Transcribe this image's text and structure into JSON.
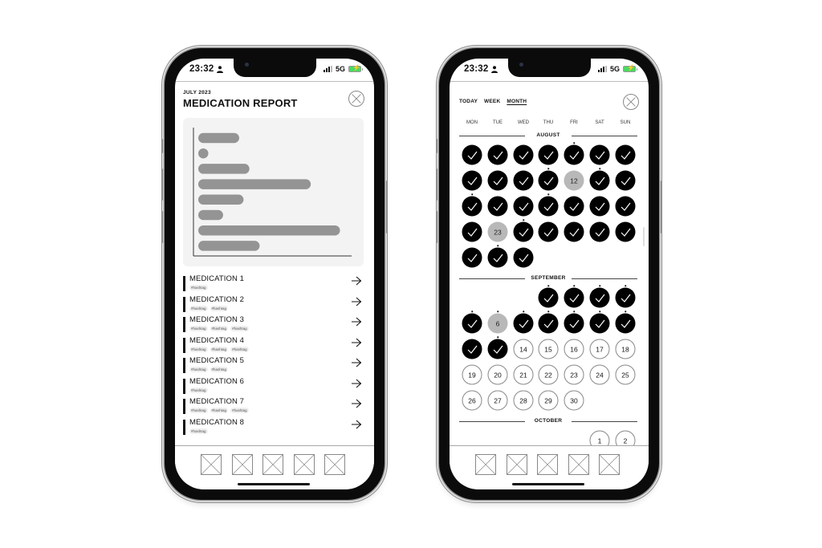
{
  "status_bar": {
    "time": "23:32",
    "network": "5G",
    "person_icon": "person-icon",
    "signal_icon": "signal-bars-icon",
    "battery_icon": "battery-charging-icon"
  },
  "report_screen": {
    "month_label": "JULY 2023",
    "title": "MEDICATION REPORT",
    "close_icon": "close-circle-icon",
    "chart_data": {
      "type": "bar",
      "orientation": "horizontal",
      "title": "",
      "xlabel": "",
      "ylabel": "",
      "categories": [
        "MEDICATION 1",
        "MEDICATION 2",
        "MEDICATION 3",
        "MEDICATION 4",
        "MEDICATION 5",
        "MEDICATION 6",
        "MEDICATION 7",
        "MEDICATION 8"
      ],
      "values": [
        28,
        4,
        35,
        77,
        31,
        17,
        97,
        42
      ],
      "xlim": [
        0,
        100
      ],
      "grid": false,
      "tick_labels_shown": false,
      "bar_color": "#949494"
    },
    "medications": [
      {
        "name": "MEDICATION 1",
        "tags": [
          "#hashtag"
        ]
      },
      {
        "name": "MEDICATION 2",
        "tags": [
          "#hashtag",
          "#hashtag"
        ]
      },
      {
        "name": "MEDICATION 3",
        "tags": [
          "#hashtag",
          "#hashtag",
          "#hashtag"
        ]
      },
      {
        "name": "MEDICATION 4",
        "tags": [
          "#hashtag",
          "#hashtag",
          "#hashtag"
        ]
      },
      {
        "name": "MEDICATION 5",
        "tags": [
          "#hashtag",
          "#hashtag"
        ]
      },
      {
        "name": "MEDICATION 6",
        "tags": [
          "#hashtag"
        ]
      },
      {
        "name": "MEDICATION 7",
        "tags": [
          "#hashtag",
          "#hashtag",
          "#hashtag"
        ]
      },
      {
        "name": "MEDICATION 8",
        "tags": [
          "#hashtag"
        ]
      }
    ],
    "tab_bar": [
      "placeholder-icon",
      "placeholder-icon",
      "placeholder-icon",
      "placeholder-icon",
      "placeholder-icon"
    ]
  },
  "calendar_screen": {
    "view_tabs": [
      {
        "label": "TODAY",
        "active": false
      },
      {
        "label": "WEEK",
        "active": false
      },
      {
        "label": "MONTH",
        "active": true
      }
    ],
    "weekdays": [
      "MON",
      "TUE",
      "WED",
      "THU",
      "FRI",
      "SAT",
      "SUN"
    ],
    "months": [
      {
        "name": "AUGUST",
        "start_weekday": 0,
        "days": 31,
        "missed": [
          12,
          23
        ],
        "taken_through": 31,
        "marked": [
          5,
          11,
          13,
          15,
          18,
          24,
          30
        ]
      },
      {
        "name": "SEPTEMBER",
        "start_weekday": 3,
        "days": 30,
        "missed": [
          6
        ],
        "taken_through": 13,
        "marked": [
          1,
          2,
          3,
          4,
          5,
          6,
          7,
          8,
          9,
          10,
          11,
          13
        ]
      },
      {
        "name": "OCTOBER",
        "start_weekday": 5,
        "days_visible": [
          1,
          2
        ],
        "missed": [],
        "taken_through": 0,
        "marked": []
      }
    ],
    "colors": {
      "taken": "#000000",
      "missed": "#b8b8b8",
      "future": "#ffffff"
    },
    "close_icon": "close-circle-icon",
    "check_icon": "checkmark-icon",
    "tab_bar": [
      "placeholder-icon",
      "placeholder-icon",
      "placeholder-icon",
      "placeholder-icon",
      "placeholder-icon"
    ]
  }
}
